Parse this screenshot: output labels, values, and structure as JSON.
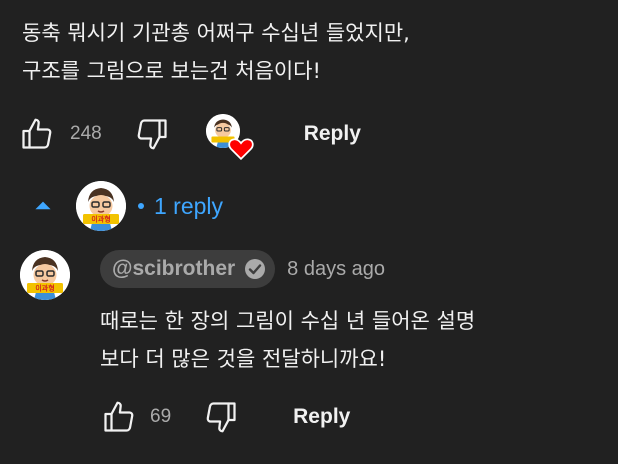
{
  "comment": {
    "text_line1": "동축 뭐시기 기관총 어쩌구 수십년 들었지만,",
    "text_line2": "구조를 그림으로 보는건 처음이다!",
    "like_count": "248",
    "reply_label": "Reply",
    "like_icon": "thumbs-up-icon",
    "dislike_icon": "thumbs-down-icon",
    "creator_heart_icon": "creator-heart-icon"
  },
  "replies_toggle": {
    "label": "1 reply",
    "arrow_icon": "chevron-up-icon"
  },
  "reply": {
    "author_handle": "@scibrother",
    "verified_icon": "verified-check-icon",
    "time": "8 days ago",
    "text_line1": "때로는 한 장의 그림이 수십 년 들어온 설명",
    "text_line2": "보다 더 많은 것을 전달하니까요!",
    "like_count": "69",
    "reply_label": "Reply"
  },
  "avatar": {
    "badge_text": "이과형"
  },
  "colors": {
    "background": "#212121",
    "accent_blue": "#3ea6ff",
    "heart_red": "#ff0000",
    "text_primary": "#f1f1f1",
    "text_secondary": "#aaaaaa",
    "chip_bg": "#3d3d3d"
  }
}
